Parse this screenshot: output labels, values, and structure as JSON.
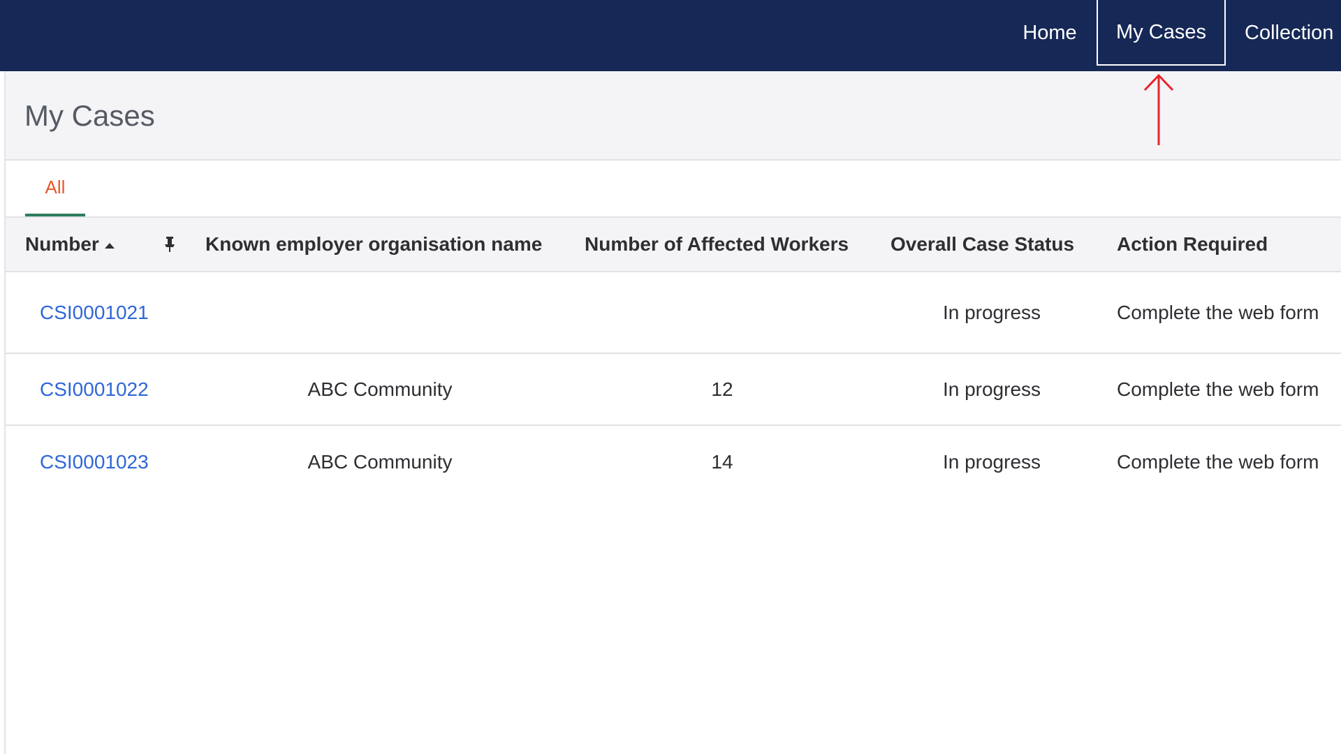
{
  "nav": {
    "home": "Home",
    "my_cases": "My Cases",
    "collection": "Collection"
  },
  "page": {
    "title": "My Cases"
  },
  "tabs": {
    "all": "All"
  },
  "table": {
    "headers": {
      "number": "Number",
      "employer": "Known employer organisation name",
      "affected": "Number of Affected Workers",
      "status": "Overall Case Status",
      "action": "Action Required"
    },
    "rows": [
      {
        "number": "CSI0001021",
        "employer": "",
        "affected": "",
        "status": "In progress",
        "action": "Complete the web form"
      },
      {
        "number": "CSI0001022",
        "employer": "ABC Community",
        "affected": "12",
        "status": "In progress",
        "action": "Complete the web form"
      },
      {
        "number": "CSI0001023",
        "employer": "ABC Community",
        "affected": "14",
        "status": "In progress",
        "action": "Complete the web form"
      }
    ]
  },
  "colors": {
    "topbar": "#162856",
    "active_tab": "#e8562a",
    "tab_underline": "#2e7d5b",
    "link": "#2f66d8",
    "annotation_arrow": "#e8232a"
  },
  "icons": {
    "pin": "pin-icon",
    "sort": "sort-ascending-icon",
    "annotation": "red-arrow-annotation"
  }
}
